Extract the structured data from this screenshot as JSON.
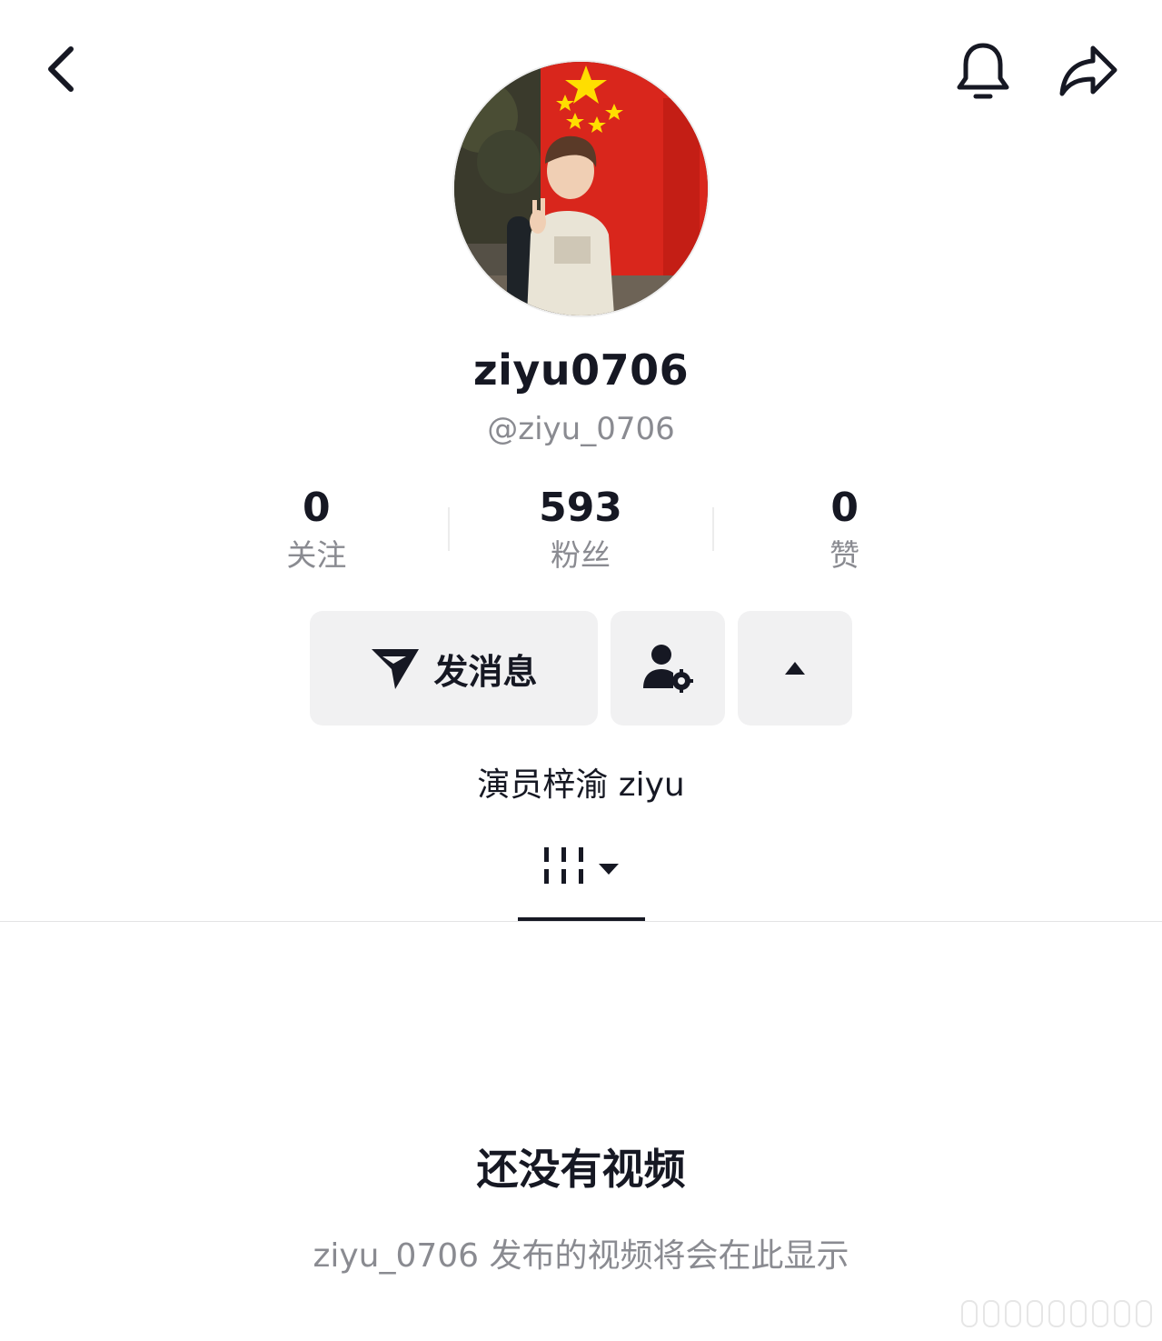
{
  "header": {
    "back_icon": "chevron-left-icon",
    "bell_icon": "bell-icon",
    "share_icon": "share-arrow-icon"
  },
  "profile": {
    "nickname": "ziyu0706",
    "handle": "@ziyu_0706",
    "bio": "演员梓渝 ziyu"
  },
  "stats": [
    {
      "value": "0",
      "label": "关注"
    },
    {
      "value": "593",
      "label": "粉丝"
    },
    {
      "value": "0",
      "label": "赞"
    }
  ],
  "actions": {
    "message_label": "发消息",
    "message_icon": "send-icon",
    "friend_icon": "person-settings-icon",
    "more_icon": "caret-up-icon"
  },
  "tabs": {
    "active_icon": "grid-columns-icon",
    "dropdown_icon": "caret-down-icon"
  },
  "empty_state": {
    "title": "还没有视频",
    "description": "ziyu_0706 发布的视频将会在此显示"
  },
  "colors": {
    "primary_text": "#161823",
    "secondary_text": "#8a8b91",
    "button_bg": "#f1f1f2"
  }
}
